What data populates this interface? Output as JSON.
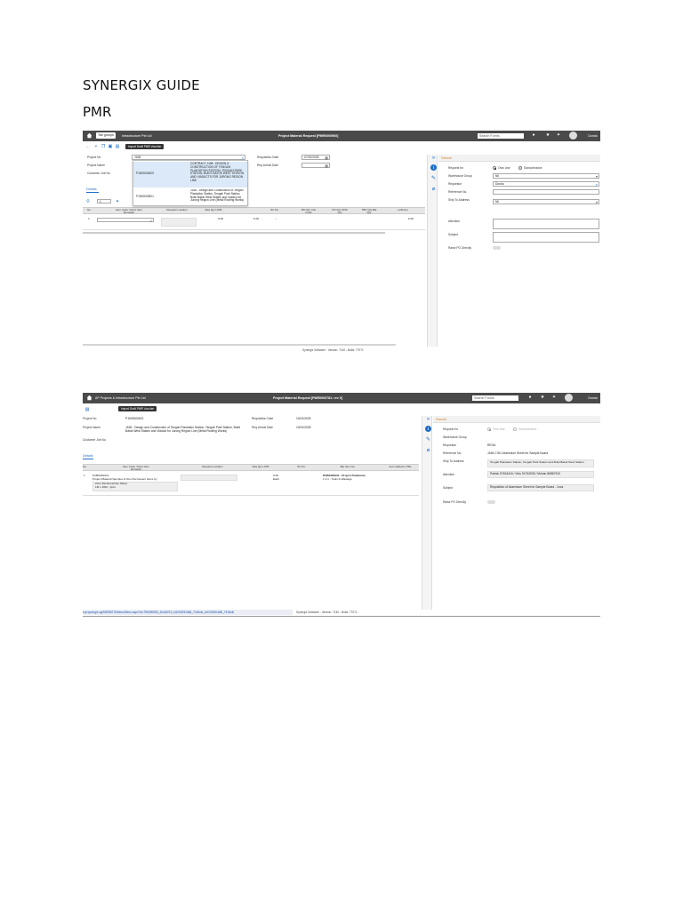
{
  "document": {
    "title": "SYNERGIX GUIDE",
    "subtitle": "PMR"
  },
  "colors": {
    "topbar": "#4a4a4a",
    "accent_blue": "#1e6ec8",
    "section_orange": "#d07a1e",
    "selected_row": "#dbe9f8"
  },
  "shot1": {
    "topbar": {
      "tab_label": "Tab groups",
      "company": "Infrastructure Pte Ltd",
      "title": "Project Material Request [PMR0000960]",
      "search_placeholder": "Search Forms",
      "user": "Dondo"
    },
    "tooltip": "Import Draft PMR Voucher",
    "form": {
      "project_no_label": "Project No",
      "project_no_value": "J168",
      "project_name_label": "Project Name",
      "customer_job_label": "Customer Job No",
      "requisition_date_label": "Requisition Date",
      "requisition_date_value": "07/02/2025",
      "req_arrival_label": "Req Arrival Date"
    },
    "dropdown": [
      {
        "code": "P1500000629",
        "desc": "CONTRACT J168 : DESIGN & CONSTRUCTION OF TENGAH PLANTATION STATION, TENGAH PARK STATION, BUKIT BATOK WEST STATION AND VIADUCTS FOR JURONG REGION LINE"
      },
      {
        "code": "P1500000821",
        "desc": "J168 - Design and Construction of Tengah Plantation Station, Tengah Park Station, Bukit Batok West Station and Viaduct for Jurong Region Line (Metal Roofing Works)"
      }
    ],
    "details_tab": "Details",
    "page_number": "1",
    "grid_headers": [
      "No.",
      "Item Code / Desc Item Remarks",
      "Request Location",
      "Req Qty UOM",
      "SU No.",
      "BO Qty Unit Code",
      "PO Qty OFM Qty",
      "TBC Qty Bal Qty",
      "LeftOver"
    ],
    "grid_row": {
      "no": "1",
      "req_qty": "0.00",
      "su": "0.00",
      "dash": "--",
      "leftover": "0.00"
    },
    "panel": {
      "header": "General",
      "request_for_label": "Request for",
      "own_use": "Own Use",
      "subcontractor": "Subcontractor",
      "warehouse_group_label": "Warehouse Group",
      "warehouse_group_value": "Nil",
      "requestor_label": "Requestor",
      "requestor_value": "Dondo",
      "reference_label": "Reference No.",
      "ship_to_label": "Ship To Address",
      "ship_to_value": "Nil",
      "attention_label": "Attention",
      "subject_label": "Subject",
      "raise_po_label": "Raise PO Directly"
    },
    "footer": "Synergix Software - Version: 7140 - Build: 77071"
  },
  "shot2": {
    "topbar": {
      "company": "AP Projects & Infrastructure Pte Ltd",
      "title": "Project Material Request [PMR0000781: rev 0]",
      "search_placeholder": "Search Forms",
      "user": "Dondo"
    },
    "tooltip": "Import Draft PMR Voucher",
    "form": {
      "project_no_label": "Project No.",
      "project_no_value": "P1500000821",
      "project_name_label": "Project Name",
      "project_name_value": "J168 - Design and Construction of Tengah Plantation Station, Tengah Park Station, Bukit Batok West Station and Viaduct for Jurong Region Line (Metal Roofing Works)",
      "customer_job_label": "Customer Job No.",
      "requisition_date_label": "Requisition Date",
      "requisition_date_value": "10/01/2025",
      "req_arrival_label": "Req Arrival Date",
      "req_arrival_value": "10/01/2025"
    },
    "details_tab": "Details",
    "grid_headers": [
      "No.",
      "Item Code / Desc Item Remarks",
      "Request Location",
      "Req Qty UOM",
      "SU No.",
      "Bgt Item No.",
      "Item added to PRs"
    ],
    "grid_row": {
      "no": "1",
      "item_code": "PUB0381014",
      "item_desc": "Project Material Samples & Non-Permanent Items by",
      "remarks_1": "2mm thk Aluminium Sheet",
      "remarks_2": "1M x 10M - 1pcs",
      "req_qty": "0.00",
      "uom": "Each",
      "bgt_item": "PUB0381001 - Project Preliminar",
      "bgt_item_2": "1.1.1 - Tools & Wastage"
    },
    "panel": {
      "header": "General",
      "request_for_label": "Request for",
      "own_use": "Own Use",
      "subcontractor": "Subcontractor",
      "warehouse_group_label": "Warehouse Group",
      "requestor_label": "Requestor",
      "requestor_value": "REGA",
      "reference_label": "Reference No.",
      "reference_value": "J168 C781 Aluminium Sheet for Sample Board",
      "ship_to_label": "Ship To Address",
      "ship_to_value": "Tengah Plantation Station, Tengah Park Station and Bukit Batok West Station",
      "attention_label": "Attention",
      "attention_value": "Patrick 97454416 / Vidu 91752635 / Mohan 86867910",
      "subject_label": "Subject",
      "subject_value": "Requisition of Aluminium Sheet for Sample Board - 1nos",
      "raise_po_label": "Raise PO Directly"
    },
    "status_url": "erp.synergix.sg/SWEB/TG/Menu/Menu.aspx?id=756090595_40ok3219_ki1230251468_7418okl_id1230251468_7418okl",
    "footer": "Synergix Software - Version: 7140 - Build: 77071"
  }
}
